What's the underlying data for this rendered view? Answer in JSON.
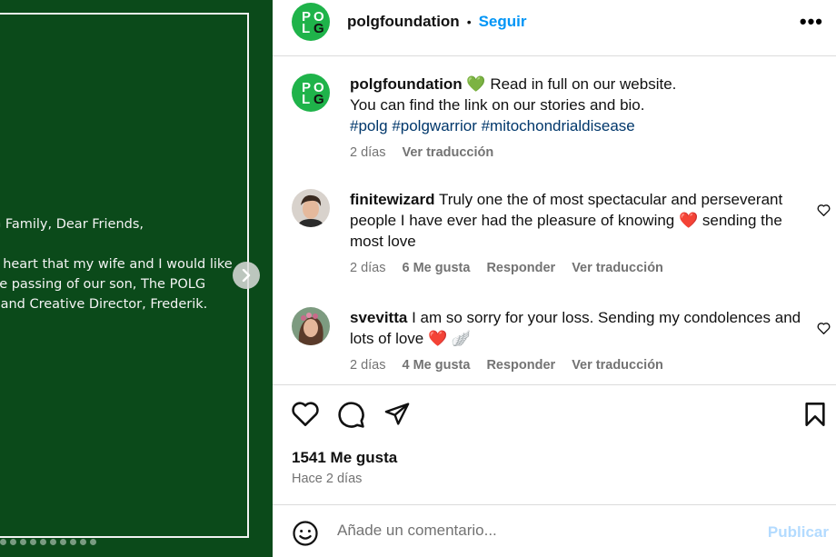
{
  "media": {
    "letter_lines_1": [
      "G Family, Dear Friends,"
    ],
    "letter_lines_2": [
      "y heart that my wife and I would like",
      "he passing of our son, The POLG",
      "r and Creative Director, Frederik."
    ],
    "next_icon": "chevron-right-icon",
    "carousel_dots": 10,
    "background": "#0b4a1a"
  },
  "header": {
    "logo_letters": [
      "P",
      "O",
      "L",
      "G"
    ],
    "username": "polgfoundation",
    "separator": "•",
    "follow_label": "Seguir",
    "more_label": "•••"
  },
  "caption": {
    "username": "polgfoundation",
    "emoji": "💚",
    "line1": "Read in full on our website.",
    "line2": "You can find the link on our stories and bio.",
    "hashtags": "#polg #polgwarrior #mitochondrialdisease",
    "time": "2 días",
    "translate": "Ver traducción"
  },
  "comments": [
    {
      "username": "finitewizard",
      "text_a": "Truly one the of most spectacular and perseverant people I have ever had the pleasure of knowing",
      "emoji": "❤️",
      "text_b": "sending the most love",
      "time": "2 días",
      "likes": "6 Me gusta",
      "reply": "Responder",
      "translate": "Ver traducción"
    },
    {
      "username": "svevitta",
      "text_a": "I am so sorry for your loss. Sending my condolences and lots of love",
      "emoji": "❤️",
      "emoji2": "🪽",
      "time": "2 días",
      "likes": "4 Me gusta",
      "reply": "Responder",
      "translate": "Ver traducción"
    }
  ],
  "actions": {
    "like_icon": "heart-icon",
    "comment_icon": "comment-icon",
    "share_icon": "send-icon",
    "save_icon": "bookmark-icon"
  },
  "stats": {
    "likes": "1541 Me gusta",
    "posted": "Hace 2 días"
  },
  "composer": {
    "placeholder": "Añade un comentario...",
    "publish_label": "Publicar",
    "emoji_icon": "smiley-icon"
  },
  "colors": {
    "accent": "#0095f6",
    "publish_disabled": "#b3dbff",
    "hashtag": "#00376b",
    "heart": "#ed1c2b",
    "logo_green": "#1fb34a"
  }
}
